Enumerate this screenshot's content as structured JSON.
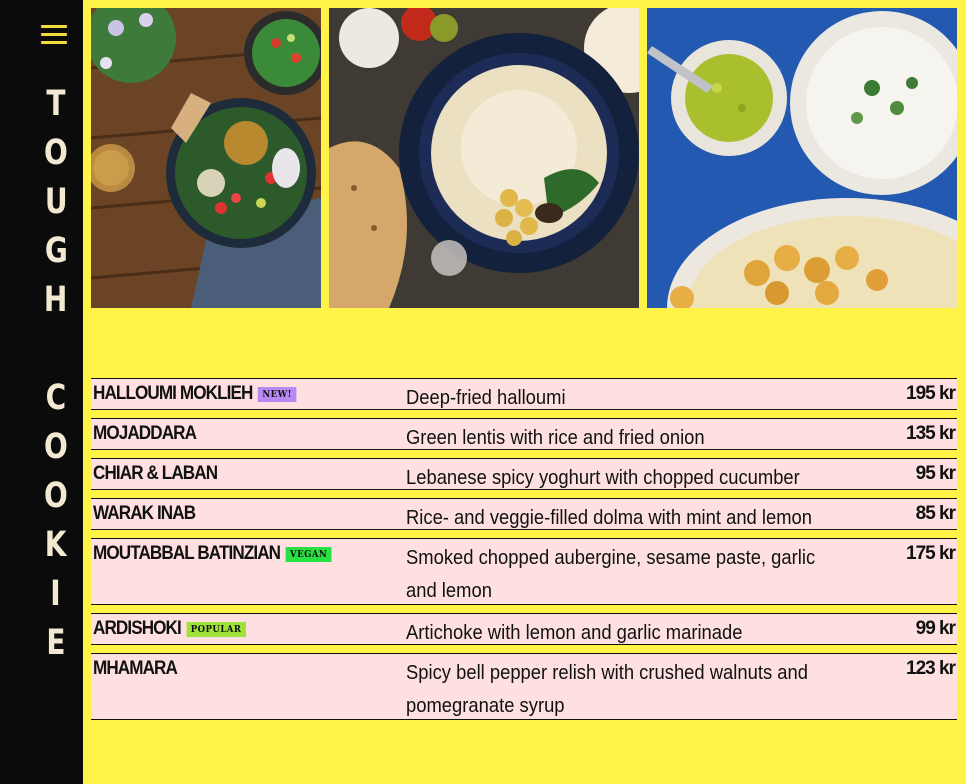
{
  "sidebar": {
    "brand_letters": [
      "T",
      "O",
      "U",
      "G",
      "H",
      "",
      "C",
      "O",
      "O",
      "K",
      "I",
      "E"
    ]
  },
  "colors": {
    "background": "#fff347",
    "sidebar": "#0b0b0b",
    "row_background": "#fde0df",
    "badge_new": "#b789f5",
    "badge_vegan": "#28e042",
    "badge_popular": "#9ee33a"
  },
  "menu": {
    "items": [
      {
        "name": "HALLOUMI MOKLIEH",
        "badge": "NEW!",
        "description": "Deep-fried halloumi",
        "price": "195 kr"
      },
      {
        "name": "MOJADDARA",
        "badge": "",
        "description": "Green lentis with rice and fried onion",
        "price": "135 kr"
      },
      {
        "name": "CHIAR & LABAN",
        "badge": "",
        "description": "Lebanese spicy yoghurt with chopped cucumber",
        "price": "95 kr"
      },
      {
        "name": "WARAK INAB",
        "badge": "",
        "description": "Rice- and veggie-filled dolma with mint and lemon",
        "price": "85 kr"
      },
      {
        "name": "MOUTABBAL BATINZIAN",
        "badge": "VEGAN",
        "description": "Smoked chopped aubergine, sesame paste, garlic and lemon",
        "price": "175 kr"
      },
      {
        "name": "ARDISHOKI",
        "badge": "POPULAR",
        "description": "Artichoke with lemon and garlic marinade",
        "price": "99 kr"
      },
      {
        "name": "MHAMARA",
        "badge": "",
        "description": "Spicy bell pepper relish with crushed walnuts and pomegranate syrup",
        "price": "123 kr"
      }
    ]
  }
}
